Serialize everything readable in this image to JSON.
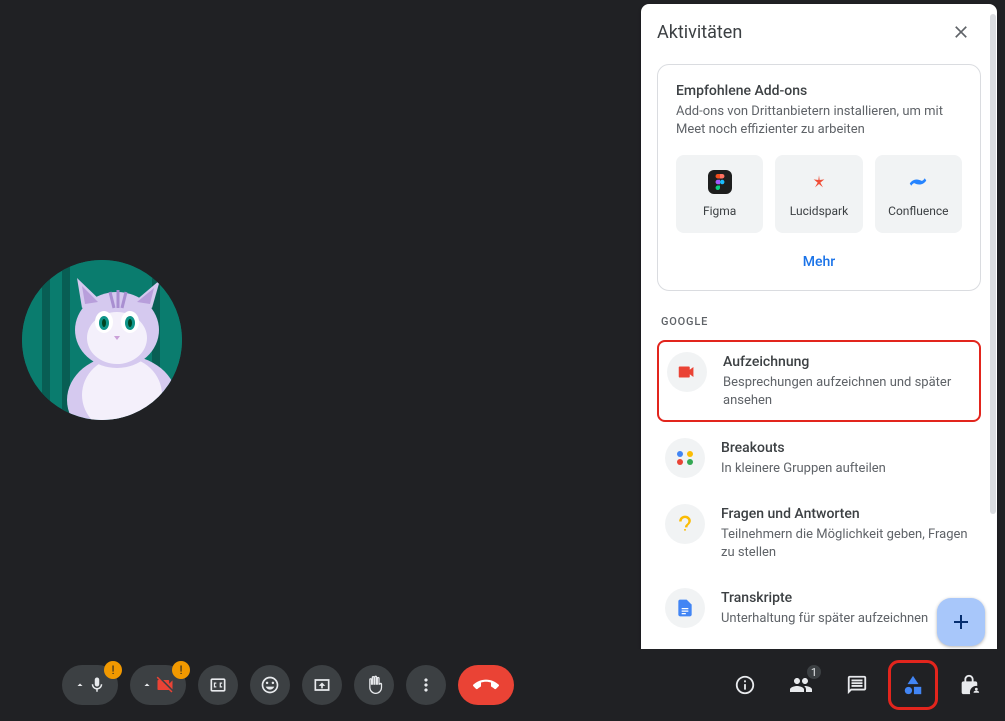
{
  "panel": {
    "title": "Aktivitäten"
  },
  "addons": {
    "title": "Empfohlene Add-ons",
    "subtitle": "Add-ons von Drittanbietern installieren, um mit Meet noch effizienter zu arbeiten",
    "more": "Mehr",
    "items": [
      {
        "label": "Figma"
      },
      {
        "label": "Lucidspark"
      },
      {
        "label": "Confluence"
      }
    ]
  },
  "section_google": "Google",
  "activities": [
    {
      "title": "Aufzeichnung",
      "desc": "Besprechungen aufzeichnen und später ansehen",
      "highlighted": true
    },
    {
      "title": "Breakouts",
      "desc": "In kleinere Gruppen aufteilen",
      "highlighted": false
    },
    {
      "title": "Fragen und Antworten",
      "desc": "Teilnehmern die Möglichkeit geben, Fragen zu stellen",
      "highlighted": false
    },
    {
      "title": "Transkripte",
      "desc": "Unterhaltung für später aufzeichnen",
      "highlighted": false
    }
  ],
  "participants_badge": "1",
  "warn_glyph": "!"
}
